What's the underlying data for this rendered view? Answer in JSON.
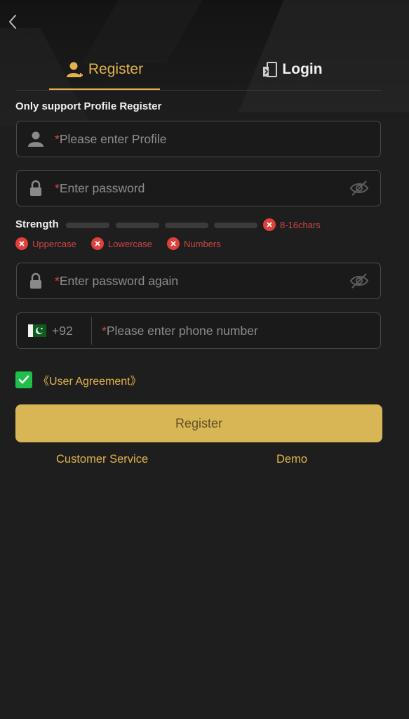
{
  "tabs": {
    "register_label": "Register",
    "login_label": "Login"
  },
  "form": {
    "hint": "Only support Profile Register",
    "profile_placeholder": "Please enter Profile",
    "password_placeholder": "Enter password",
    "password_again_placeholder": "Enter password again",
    "phone_country_code": "+92",
    "phone_placeholder": "Please enter phone number",
    "required_marker": "*"
  },
  "strength": {
    "label": "Strength",
    "rules": [
      "8-16chars",
      "Uppercase",
      "Lowercase",
      "Numbers"
    ]
  },
  "agreement": {
    "label": "《User Agreement》",
    "checked": true
  },
  "actions": {
    "submit_label": "Register",
    "customer_service": "Customer Service",
    "demo": "Demo"
  },
  "colors": {
    "accent_gold": "#e2b34b",
    "button_gold": "#d8b655",
    "error_red": "#e0403c",
    "check_green": "#1fbf4a",
    "background": "#1e1e1e"
  },
  "icons": {
    "back": "chevron-left-icon",
    "register_tab": "user-plus-icon",
    "login_tab": "door-login-icon",
    "profile": "user-icon",
    "password": "lock-icon",
    "toggle_visibility": "eye-off-icon",
    "rule_status": "x-circle-icon",
    "country_flag": "pakistan-flag-icon",
    "agreement_check": "checkmark-icon"
  }
}
